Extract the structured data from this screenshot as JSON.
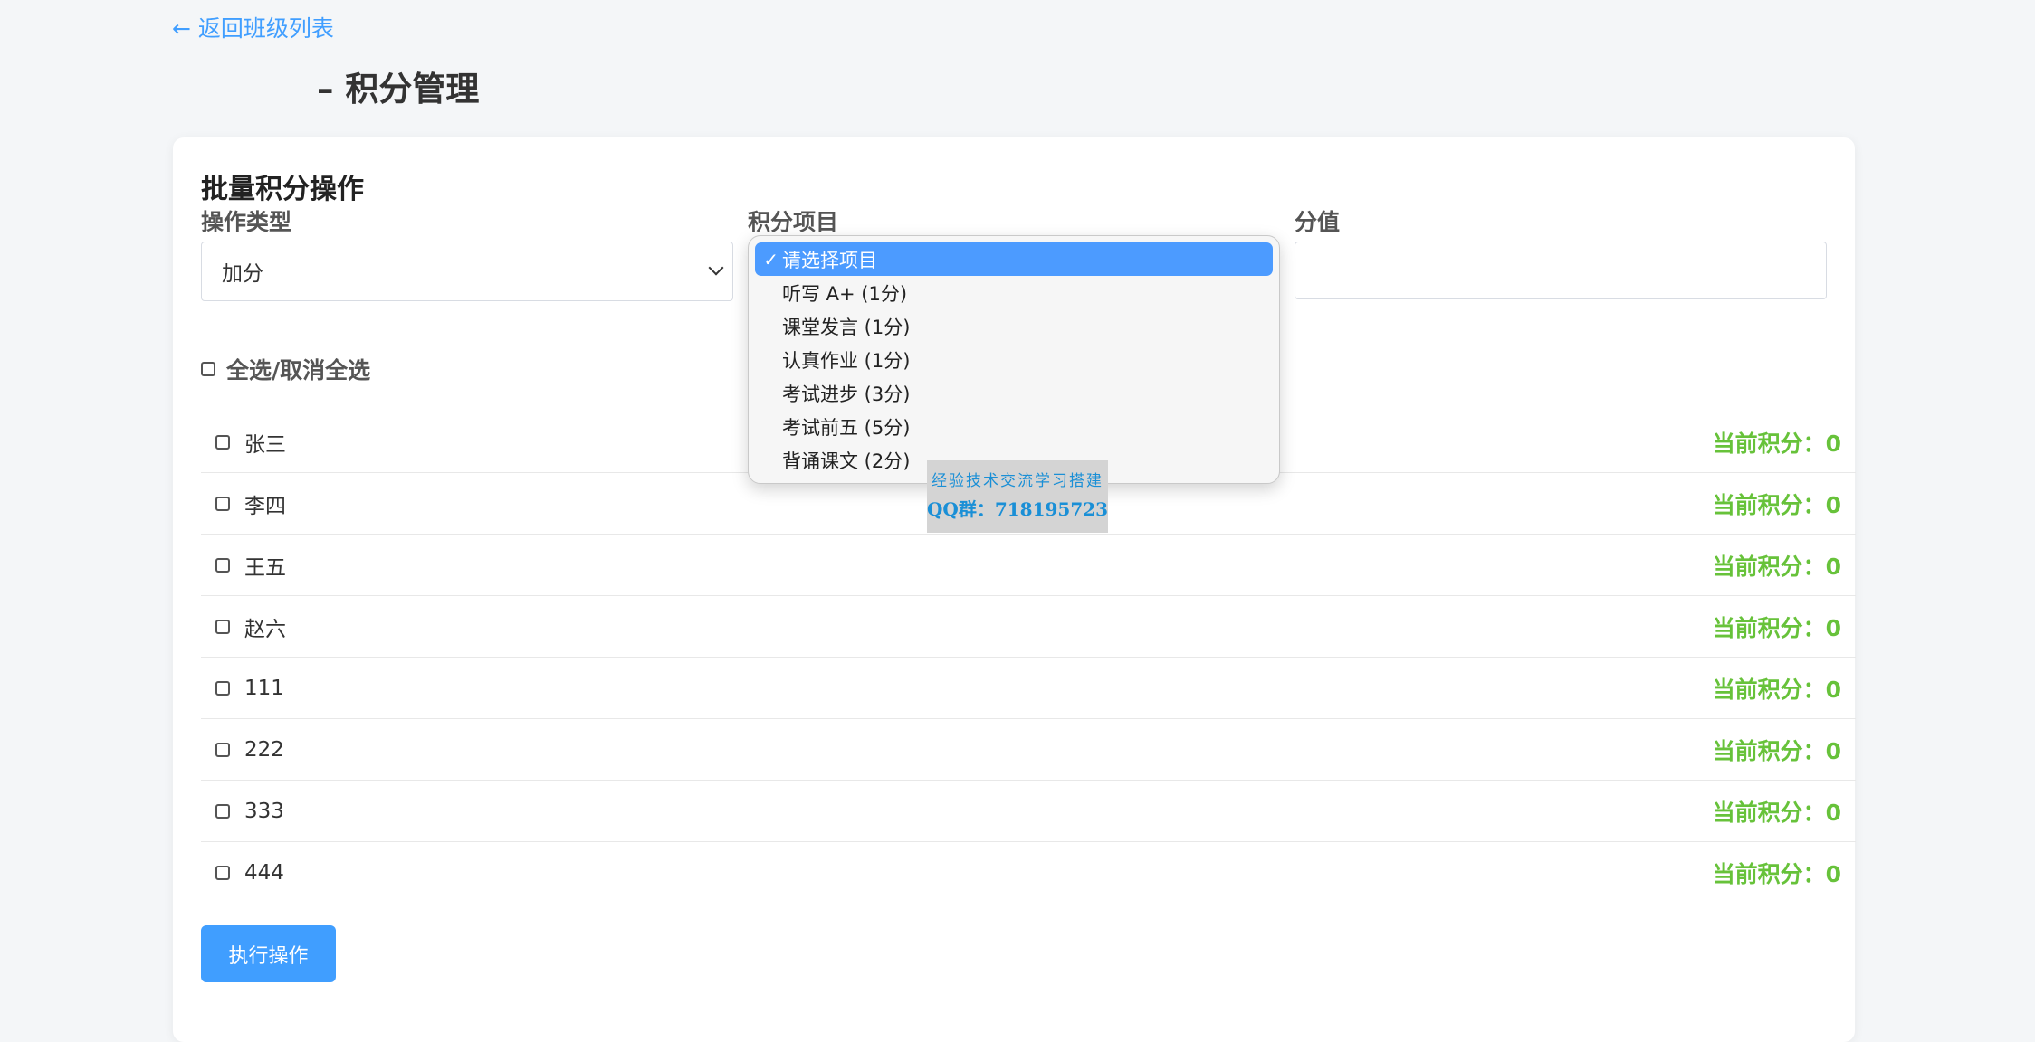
{
  "nav": {
    "back_label": "← 返回班级列表"
  },
  "page": {
    "title": "– 积分管理"
  },
  "batch": {
    "section_title": "批量积分操作",
    "op_type_label": "操作类型",
    "op_type_value": "加分",
    "item_label": "积分项目",
    "value_label": "分值",
    "value_input": ""
  },
  "dropdown": {
    "checkmark": "✓",
    "options": [
      {
        "label": "请选择项目",
        "selected": true
      },
      {
        "label": "听写 A+ (1分)",
        "selected": false
      },
      {
        "label": "课堂发言 (1分)",
        "selected": false
      },
      {
        "label": "认真作业 (1分)",
        "selected": false
      },
      {
        "label": "考试进步 (3分)",
        "selected": false
      },
      {
        "label": "考试前五 (5分)",
        "selected": false
      },
      {
        "label": "背诵课文 (2分)",
        "selected": false
      }
    ]
  },
  "select_all_label": "全选/取消全选",
  "students": [
    {
      "name": "张三",
      "score": "当前积分：0"
    },
    {
      "name": "李四",
      "score": "当前积分：0"
    },
    {
      "name": "王五",
      "score": "当前积分：0"
    },
    {
      "name": "赵六",
      "score": "当前积分：0"
    },
    {
      "name": "111",
      "score": "当前积分：0"
    },
    {
      "name": "222",
      "score": "当前积分：0"
    },
    {
      "name": "333",
      "score": "当前积分：0"
    },
    {
      "name": "444",
      "score": "当前积分：0"
    }
  ],
  "execute_button": "执行操作",
  "watermark": {
    "line1": "经验技术交流学习搭建",
    "line2": "QQ群：718195723"
  },
  "colors": {
    "accent": "#409eff",
    "score": "#67c23a",
    "selected_option": "#4c9bff"
  }
}
